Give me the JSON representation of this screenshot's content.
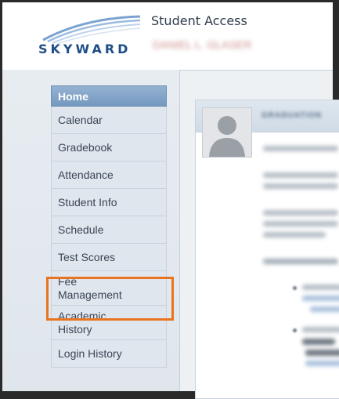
{
  "header": {
    "brand": "SKYWARD",
    "app_title": "Student Access",
    "user_name": "DANIEL L. GLASER"
  },
  "nav": {
    "items": [
      {
        "id": "home",
        "label": "Home",
        "active": true
      },
      {
        "id": "calendar",
        "label": "Calendar"
      },
      {
        "id": "gradebook",
        "label": "Gradebook"
      },
      {
        "id": "attendance",
        "label": "Attendance"
      },
      {
        "id": "student-info",
        "label": "Student Info"
      },
      {
        "id": "schedule",
        "label": "Schedule"
      },
      {
        "id": "test-scores",
        "label": "Test Scores"
      },
      {
        "id": "fee-management",
        "label": "Fee\nManagement",
        "highlighted": true
      },
      {
        "id": "academic-history",
        "label": "Academic\nHistory"
      },
      {
        "id": "login-history",
        "label": "Login History"
      }
    ]
  },
  "main": {
    "card_title": "GRADUATION"
  },
  "colors": {
    "brand": "#1e4e86",
    "nav_active": "#7599c0",
    "highlight": "#e9741f"
  }
}
